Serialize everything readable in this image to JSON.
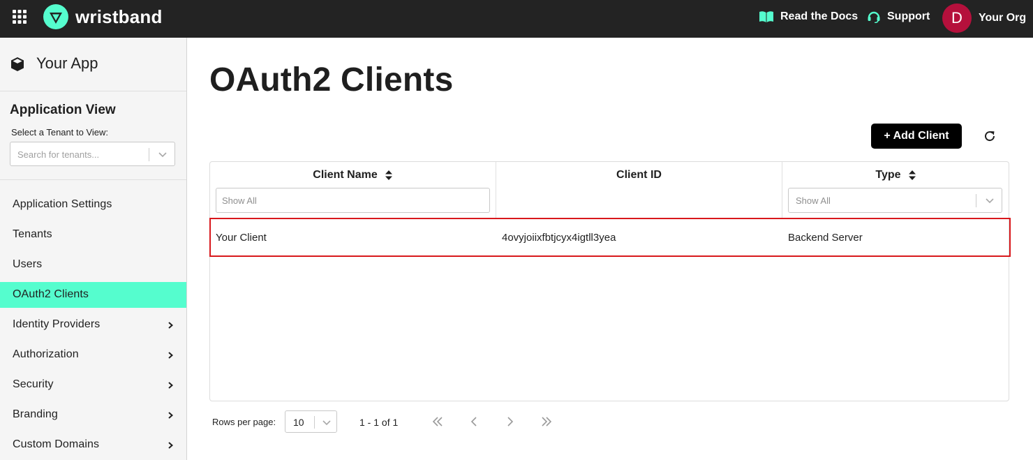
{
  "topbar": {
    "brand": "wristband",
    "docs_label": "Read the Docs",
    "support_label": "Support",
    "avatar_initial": "D",
    "org_name": "Your Org",
    "accent_color": "#55fdce",
    "avatar_color": "#b5103c"
  },
  "sidebar": {
    "app_name": "Your App",
    "view_title": "Application View",
    "tenant_label": "Select a Tenant to View:",
    "tenant_placeholder": "Search for tenants...",
    "items": [
      {
        "label": "Application Settings",
        "active": false,
        "expandable": false
      },
      {
        "label": "Tenants",
        "active": false,
        "expandable": false
      },
      {
        "label": "Users",
        "active": false,
        "expandable": false
      },
      {
        "label": "OAuth2 Clients",
        "active": true,
        "expandable": false
      },
      {
        "label": "Identity Providers",
        "active": false,
        "expandable": true
      },
      {
        "label": "Authorization",
        "active": false,
        "expandable": true
      },
      {
        "label": "Security",
        "active": false,
        "expandable": true
      },
      {
        "label": "Branding",
        "active": false,
        "expandable": true
      },
      {
        "label": "Custom Domains",
        "active": false,
        "expandable": true
      }
    ]
  },
  "main": {
    "title": "OAuth2 Clients",
    "add_button_label": "+ Add Client",
    "table": {
      "columns": [
        {
          "label": "Client Name",
          "sortable": true,
          "filter": "Show All"
        },
        {
          "label": "Client ID",
          "sortable": false,
          "filter": ""
        },
        {
          "label": "Type",
          "sortable": true,
          "filter": "Show All"
        }
      ],
      "rows": [
        {
          "client_name": "Your Client",
          "client_id": "4ovyjoiixfbtjcyx4igtll3yea",
          "type": "Backend Server"
        }
      ]
    },
    "pagination": {
      "rows_per_page_label": "Rows per page:",
      "rows_per_page": "10",
      "range": "1 - 1  of  1"
    }
  }
}
